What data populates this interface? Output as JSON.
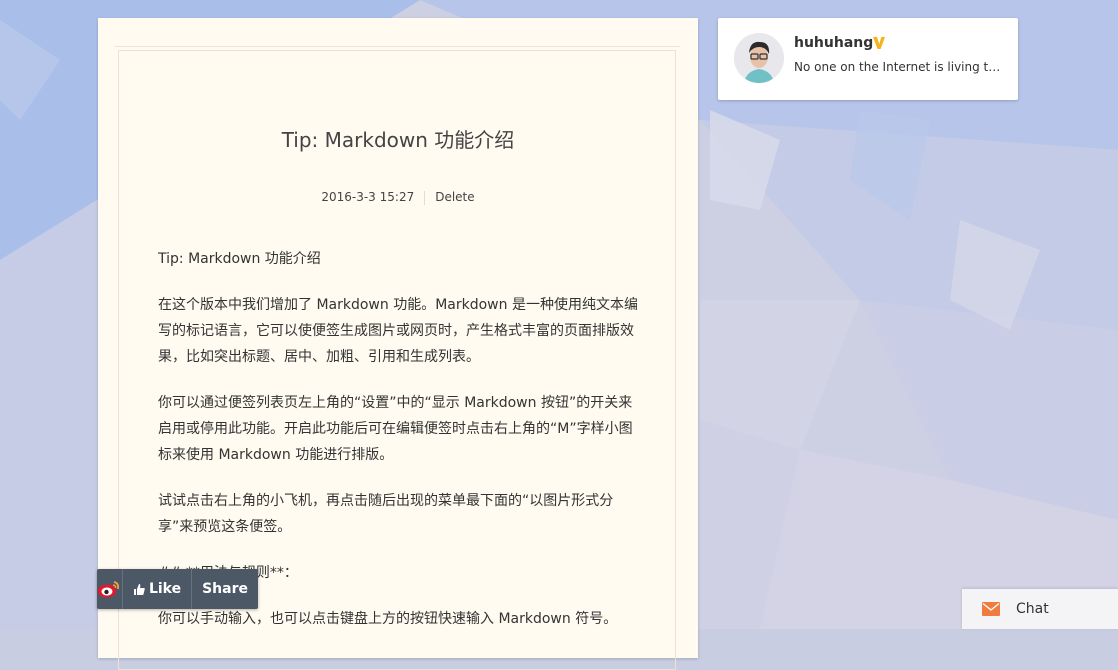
{
  "article": {
    "title": "Tip: Markdown 功能介绍",
    "date": "2016-3-3 15:27",
    "delete_label": "Delete",
    "paragraphs": [
      "Tip: Markdown 功能介绍",
      "在这个版本中我们增加了 Markdown 功能。Markdown 是一种使用纯文本编写的标记语言，它可以使便签生成图片或网页时，产生格式丰富的页面排版效果，比如突出标题、居中、加粗、引用和生成列表。",
      "你可以通过便签列表页左上角的“设置”中的“显示 Markdown 按钮”的开关来启用或停用此功能。开启此功能后可在编辑便签时点击右上角的“M”字样小图标来使用 Markdown 功能进行排版。",
      "试试点击右上角的小飞机，再点击随后出现的菜单最下面的“以图片形式分享”来预览这条便签。",
      "## **用法与规则**：",
      "你可以手动输入，也可以点击键盘上方的按钮快速输入 Markdown 符号。"
    ]
  },
  "profile": {
    "username": "huhuhang",
    "bio": "No one on the Internet is living the life they present online",
    "verified_icon": "verified-v-icon",
    "avatar_icon": "avatar-icon"
  },
  "share_bar": {
    "weibo_icon": "weibo-icon",
    "like_label": "Like",
    "share_label": "Share"
  },
  "chat": {
    "label": "Chat",
    "icon": "mail-icon",
    "accent": "#f07b3f"
  }
}
